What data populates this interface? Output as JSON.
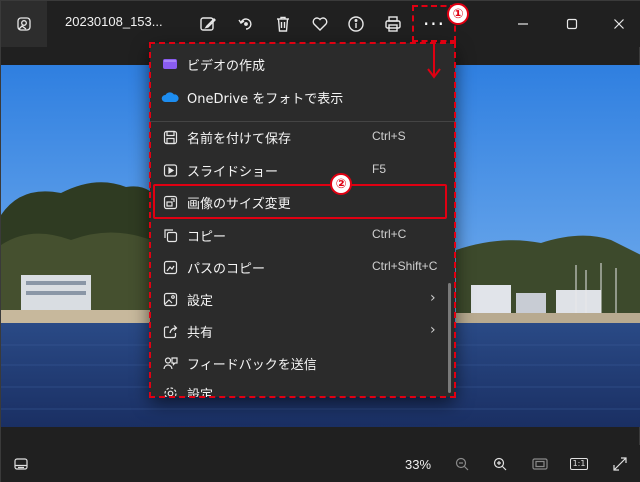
{
  "title_bar": {
    "file_name": "20230108_153...",
    "toolbar_icons": [
      "edit-image-icon",
      "rotate-icon",
      "delete-icon",
      "favorite-icon",
      "info-icon",
      "print-icon",
      "more-options-icon"
    ],
    "more_label": "···",
    "window_controls": [
      "minimize-icon",
      "maximize-icon",
      "close-icon"
    ]
  },
  "menu": {
    "items": [
      {
        "label": "ビデオの作成",
        "shortcut": "",
        "icon": "video-create-icon"
      },
      {
        "label": "OneDrive をフォトで表示",
        "shortcut": "",
        "icon": "onedrive-icon"
      },
      {
        "label": "名前を付けて保存",
        "shortcut": "Ctrl+S",
        "icon": "save-icon"
      },
      {
        "label": "スライドショー",
        "shortcut": "F5",
        "icon": "slideshow-icon"
      },
      {
        "label": "画像のサイズ変更",
        "shortcut": "",
        "icon": "resize-image-icon"
      },
      {
        "label": "コピー",
        "shortcut": "Ctrl+C",
        "icon": "copy-icon"
      },
      {
        "label": "パスのコピー",
        "shortcut": "Ctrl+Shift+C",
        "icon": "copy-path-icon"
      },
      {
        "label": "設定",
        "shortcut": "",
        "icon": "set-as-icon",
        "submenu": true
      },
      {
        "label": "共有",
        "shortcut": "",
        "icon": "share-icon",
        "submenu": true
      },
      {
        "label": "フィードバックを送信",
        "shortcut": "",
        "icon": "feedback-icon"
      },
      {
        "label": "設定",
        "shortcut": "",
        "icon": "settings-icon"
      }
    ]
  },
  "annotations": {
    "step1": "①",
    "step2": "②",
    "color": "#e00012"
  },
  "bottom_bar": {
    "zoom": "33%",
    "icons": [
      "filmstrip-icon",
      "zoom-out-icon",
      "zoom-in-icon",
      "fit-window-icon",
      "actual-size-icon",
      "fullscreen-icon"
    ],
    "actual_size_label": "1:1"
  },
  "colors": {
    "background": "#202020",
    "menu_background": "#2b2b2b",
    "annotation_red": "#e00012"
  }
}
